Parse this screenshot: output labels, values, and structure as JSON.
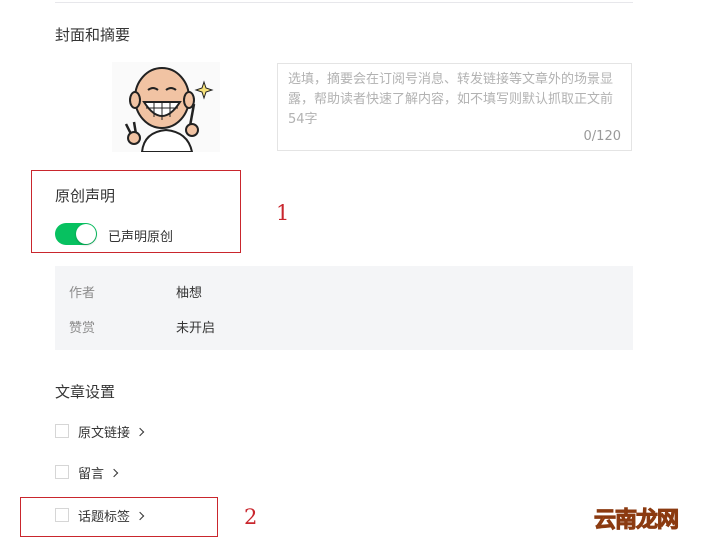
{
  "cover_section": {
    "title": "封面和摘要"
  },
  "summary": {
    "placeholder": "选填，摘要会在订阅号消息、转发链接等文章外的场景显露，帮助读者快速了解内容，如不填写则默认抓取正文前54字",
    "count": "0/120"
  },
  "original": {
    "title": "原创声明",
    "toggle_label": "已声明原创",
    "toggle_on": true
  },
  "info": {
    "author_label": "作者",
    "author_value": "柚想",
    "reward_label": "赞赏",
    "reward_value": "未开启"
  },
  "article_settings": {
    "title": "文章设置",
    "items": [
      {
        "label": "原文链接"
      },
      {
        "label": "留言"
      },
      {
        "label": "话题标签"
      }
    ]
  },
  "annotations": {
    "one": "1",
    "two": "2"
  },
  "watermark": "云南龙网",
  "colors": {
    "toggle_on": "#07c160",
    "annotation": "#c9262d"
  }
}
